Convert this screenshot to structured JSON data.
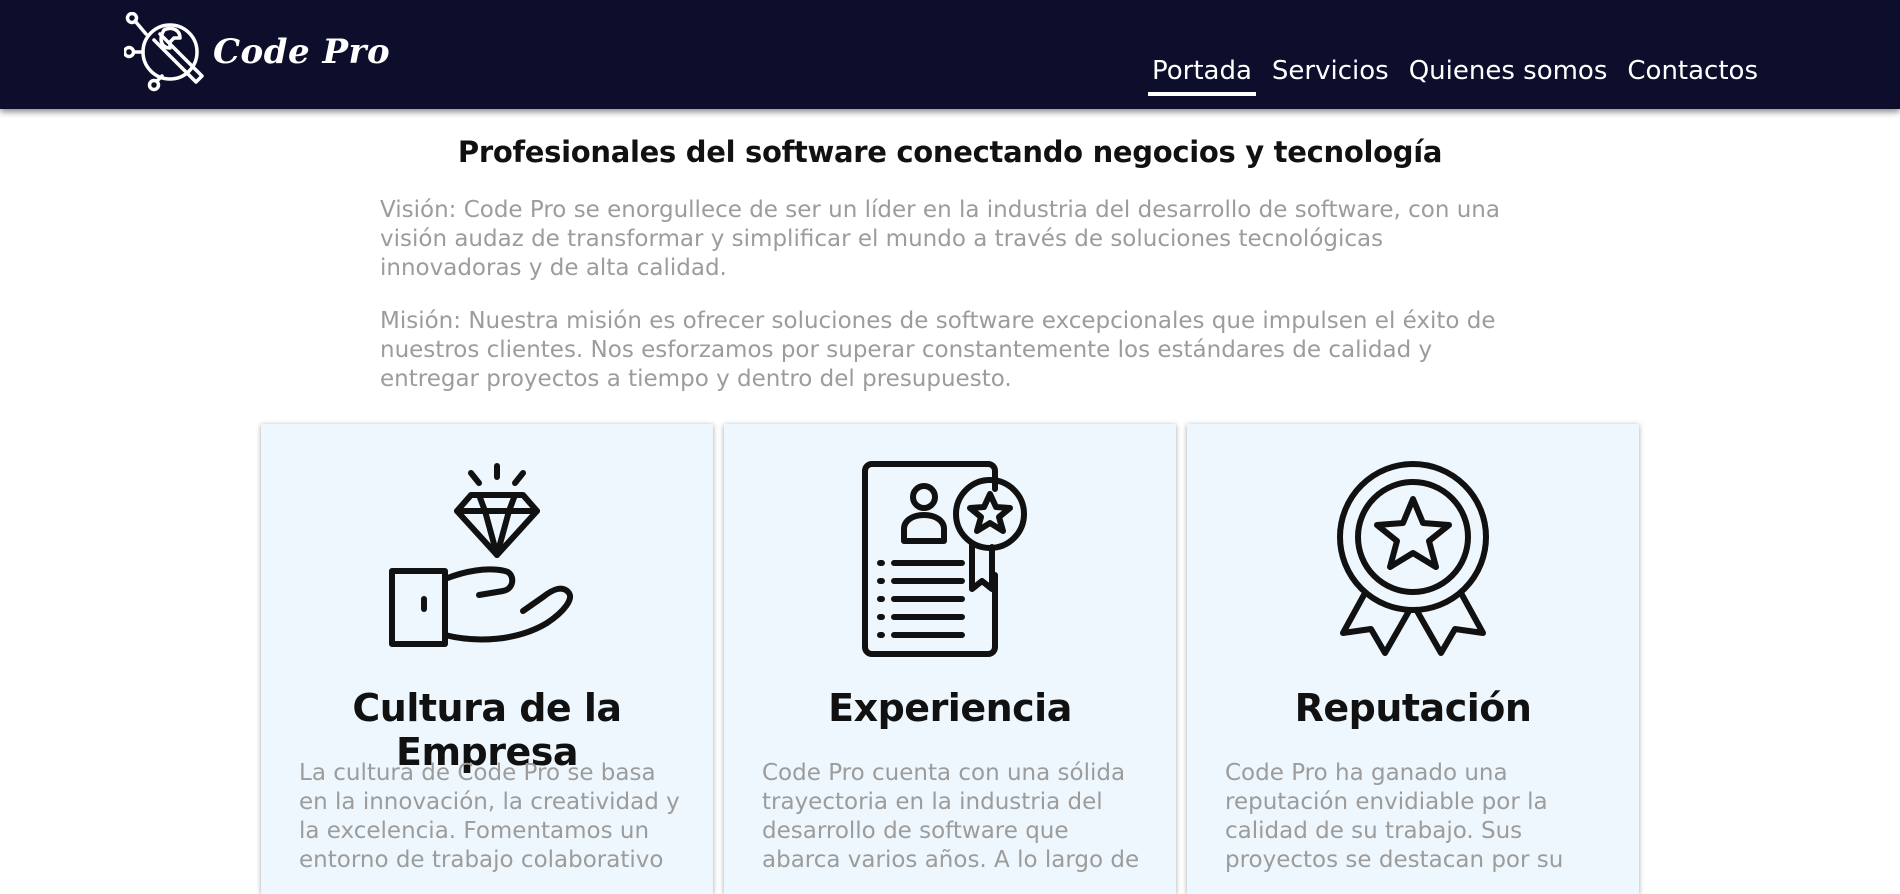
{
  "brand": {
    "name": "Code Pro"
  },
  "nav": {
    "items": [
      {
        "label": "Portada",
        "active": true
      },
      {
        "label": "Servicios",
        "active": false
      },
      {
        "label": "Quienes somos",
        "active": false
      },
      {
        "label": "Contactos",
        "active": false
      }
    ]
  },
  "hero": {
    "headline": "Profesionales del software conectando negocios y tecnología",
    "vision": "Visión: Code Pro se enorgullece de ser un líder en la industria del desarrollo de software, con una visión audaz de transformar y simplificar el mundo a través de soluciones tecnológicas innovadoras y de alta calidad.",
    "mission": "Misión: Nuestra misión es ofrecer soluciones de software excepcionales que impulsen el éxito de nuestros clientes. Nos esforzamos por superar constantemente los estándares de calidad y entregar proyectos a tiempo y dentro del presupuesto."
  },
  "cards": [
    {
      "icon": "diamond-hand-icon",
      "title": "Cultura de la Empresa",
      "text": "La cultura de Code Pro se basa en la innovación, la creatividad y la excelencia. Fomentamos un entorno de trabajo colaborativo"
    },
    {
      "icon": "certificate-icon",
      "title": "Experiencia",
      "text": "Code Pro cuenta con una sólida trayectoria en la industria del desarrollo de software que abarca varios años. A lo largo de"
    },
    {
      "icon": "medal-icon",
      "title": "Reputación",
      "text": "Code Pro ha ganado una reputación envidiable por la calidad de su trabajo. Sus proyectos se destacan por su"
    }
  ],
  "colors": {
    "navbar": "#0c0e2b",
    "card_bg": "#eef7fd",
    "muted_text": "#9c9c9c"
  }
}
